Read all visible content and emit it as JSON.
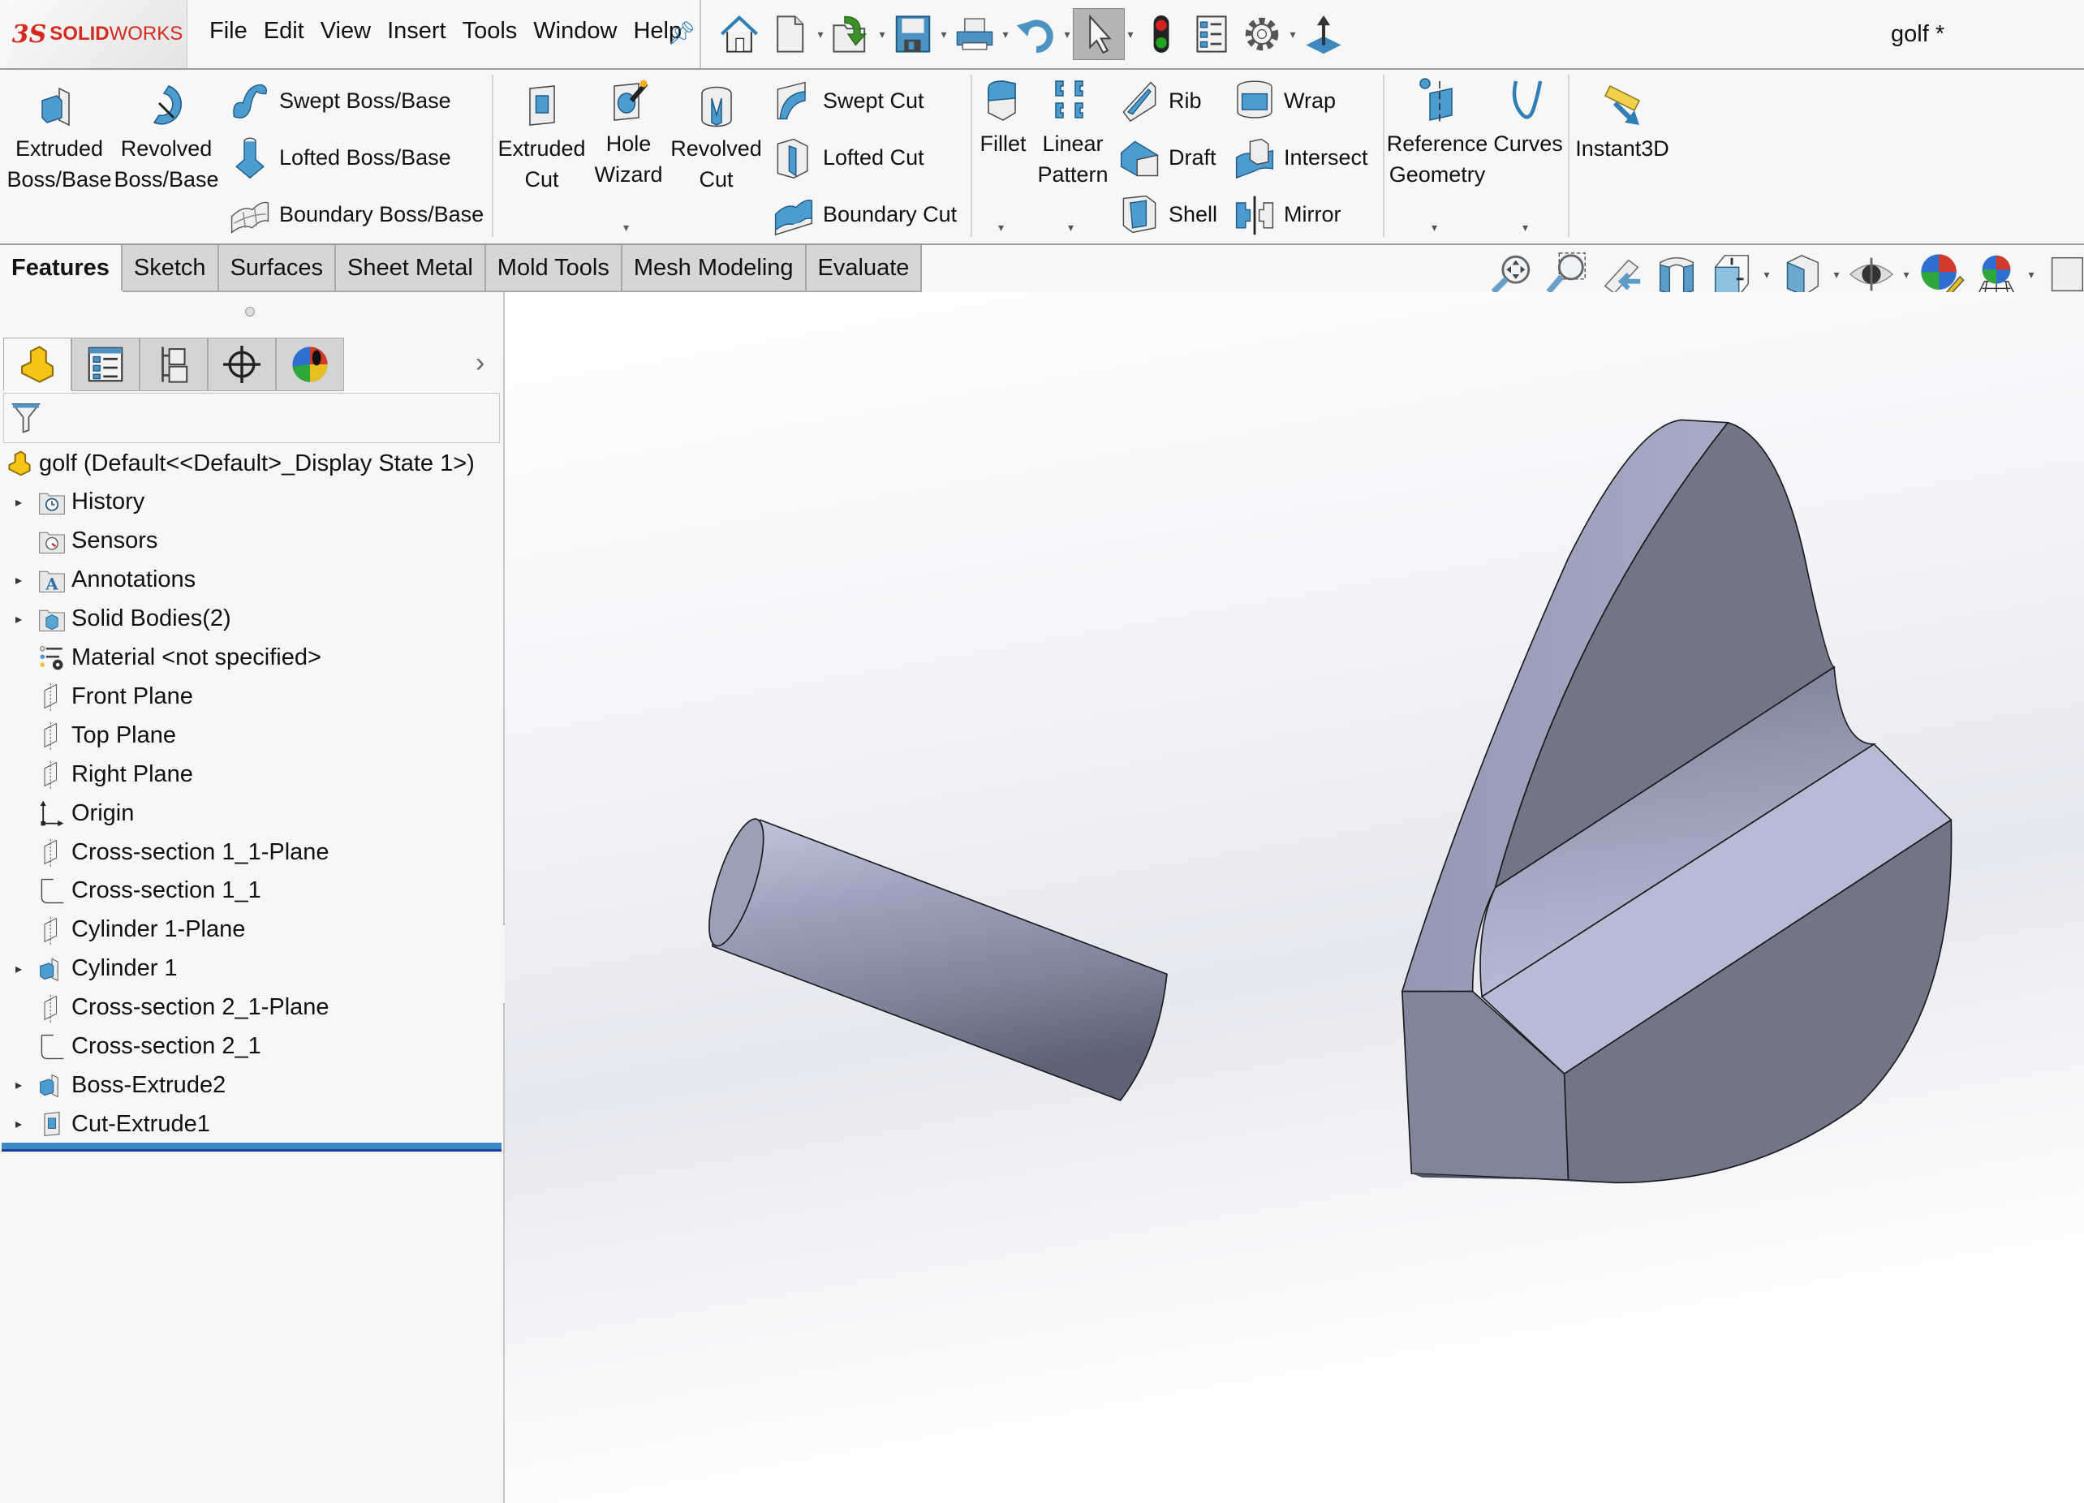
{
  "app": {
    "brand_prefix": "3S",
    "brand_name_bold": "SOLID",
    "brand_name": "WORKS",
    "document_title": "golf *"
  },
  "menu": [
    "File",
    "Edit",
    "View",
    "Insert",
    "Tools",
    "Window",
    "Help"
  ],
  "quick_access": [
    {
      "icon": "home-icon",
      "dropdown": false
    },
    {
      "icon": "new-document-icon",
      "dropdown": true
    },
    {
      "icon": "open-folder-icon",
      "dropdown": true
    },
    {
      "icon": "save-icon",
      "dropdown": true
    },
    {
      "icon": "print-icon",
      "dropdown": true
    },
    {
      "icon": "undo-icon",
      "dropdown": true
    },
    {
      "icon": "select-cursor-icon",
      "dropdown": true,
      "active": true
    },
    {
      "icon": "rebuild-traffic-light-icon",
      "dropdown": false
    },
    {
      "icon": "file-properties-icon",
      "dropdown": false
    },
    {
      "icon": "options-gear-icon",
      "dropdown": true
    },
    {
      "icon": "move-arrow-icon",
      "dropdown": false
    }
  ],
  "ribbon": {
    "extruded_boss": [
      "Extruded",
      "Boss/Base"
    ],
    "revolved_boss": [
      "Revolved",
      "Boss/Base"
    ],
    "swept_boss": "Swept Boss/Base",
    "lofted_boss": "Lofted Boss/Base",
    "boundary_boss": "Boundary Boss/Base",
    "extruded_cut": [
      "Extruded",
      "Cut"
    ],
    "hole_wizard": [
      "Hole",
      "Wizard"
    ],
    "revolved_cut": [
      "Revolved",
      "Cut"
    ],
    "swept_cut": "Swept Cut",
    "lofted_cut": "Lofted Cut",
    "boundary_cut": "Boundary Cut",
    "fillet": "Fillet",
    "linear_pattern": [
      "Linear",
      "Pattern"
    ],
    "rib": "Rib",
    "wrap": "Wrap",
    "draft": "Draft",
    "intersect": "Intersect",
    "shell": "Shell",
    "mirror": "Mirror",
    "reference_geometry": [
      "Reference",
      "Geometry"
    ],
    "curves": "Curves",
    "instant3d": "Instant3D"
  },
  "tabs": [
    {
      "label": "Features",
      "active": true
    },
    {
      "label": "Sketch"
    },
    {
      "label": "Surfaces"
    },
    {
      "label": "Sheet Metal"
    },
    {
      "label": "Mold Tools"
    },
    {
      "label": "Mesh Modeling"
    },
    {
      "label": "Evaluate"
    }
  ],
  "view_toolbar": [
    "zoom-to-fit-icon",
    "zoom-to-area-icon",
    "previous-view-icon",
    "section-view-icon",
    "view-orientation-icon",
    "display-style-icon",
    "hide-show-items-icon",
    "edit-appearance-icon",
    "apply-scene-icon",
    "view-settings-icon"
  ],
  "panel_tabs": [
    "feature-manager-icon",
    "property-manager-icon",
    "configuration-manager-icon",
    "dimxpert-icon",
    "display-manager-icon"
  ],
  "tree": {
    "root": "golf  (Default<<Default>_Display State 1>)",
    "items": [
      {
        "label": "History",
        "icon": "history-folder-icon",
        "expandable": true
      },
      {
        "label": "Sensors",
        "icon": "sensors-folder-icon",
        "expandable": false
      },
      {
        "label": "Annotations",
        "icon": "annotations-folder-icon",
        "expandable": true
      },
      {
        "label": "Solid Bodies(2)",
        "icon": "solid-bodies-folder-icon",
        "expandable": true
      },
      {
        "label": "Material <not specified>",
        "icon": "material-icon",
        "expandable": false
      },
      {
        "label": "Front Plane",
        "icon": "plane-icon",
        "expandable": false
      },
      {
        "label": "Top Plane",
        "icon": "plane-icon",
        "expandable": false
      },
      {
        "label": "Right Plane",
        "icon": "plane-icon",
        "expandable": false
      },
      {
        "label": "Origin",
        "icon": "origin-icon",
        "expandable": false
      },
      {
        "label": "Cross-section 1_1-Plane",
        "icon": "plane-icon",
        "expandable": false
      },
      {
        "label": "Cross-section 1_1",
        "icon": "sketch-icon",
        "expandable": false
      },
      {
        "label": "Cylinder 1-Plane",
        "icon": "plane-icon",
        "expandable": false
      },
      {
        "label": "Cylinder 1",
        "icon": "boss-extrude-icon",
        "expandable": true
      },
      {
        "label": "Cross-section 2_1-Plane",
        "icon": "plane-icon",
        "expandable": false
      },
      {
        "label": "Cross-section 2_1",
        "icon": "sketch-icon",
        "expandable": false
      },
      {
        "label": "Boss-Extrude2",
        "icon": "boss-extrude-icon",
        "expandable": true
      },
      {
        "label": "Cut-Extrude1",
        "icon": "cut-extrude-icon",
        "expandable": true
      }
    ]
  },
  "colors": {
    "brand_red": "#d52b1e",
    "rollback_bar": "#3a8ac4",
    "model_light": "#b7bbd6",
    "model_dark": "#717586",
    "model_mid": "#9da2ba"
  }
}
